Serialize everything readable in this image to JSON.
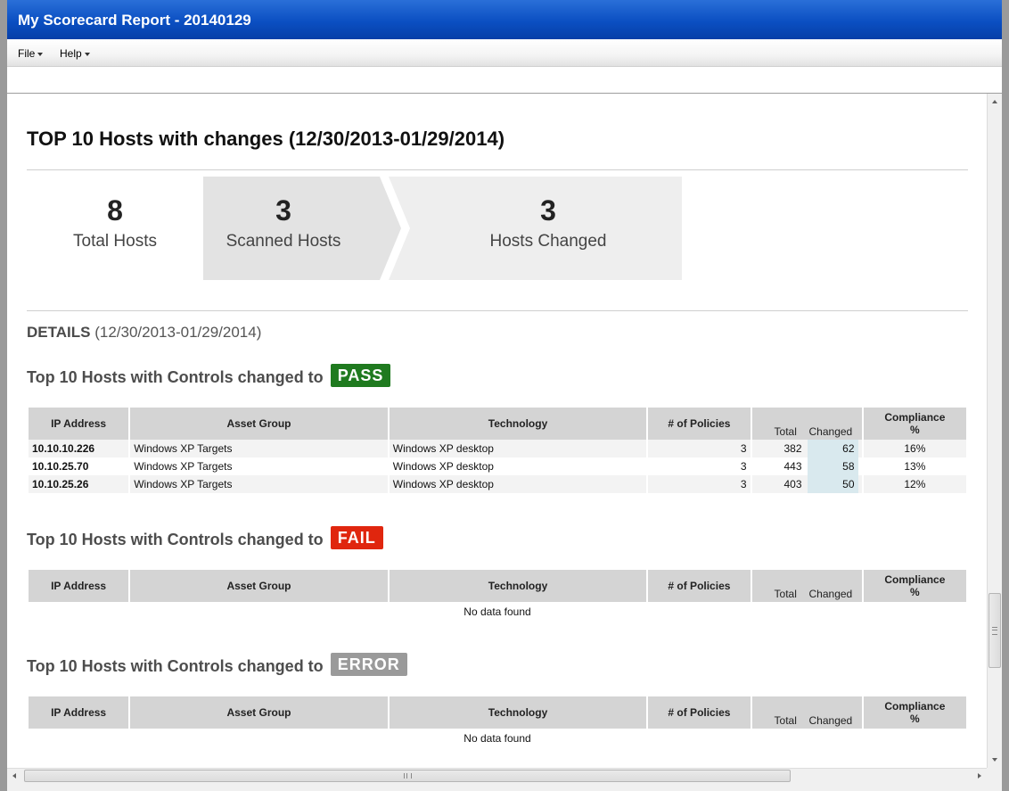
{
  "window": {
    "title": "My Scorecard Report - 20140129"
  },
  "menu": [
    {
      "label": "File"
    },
    {
      "label": "Help"
    }
  ],
  "report": {
    "title": "TOP 10 Hosts with changes (12/30/2013-01/29/2014)",
    "stats": [
      {
        "value": "8",
        "label": "Total Hosts"
      },
      {
        "value": "3",
        "label": "Scanned Hosts"
      },
      {
        "value": "3",
        "label": "Hosts Changed"
      }
    ],
    "details_label": "DETAILS",
    "details_range": "(12/30/2013-01/29/2014)"
  },
  "columns": {
    "ip": "IP Address",
    "asset_group": "Asset Group",
    "technology": "Technology",
    "policies": "# of Policies",
    "total": "Total",
    "changed": "Changed",
    "compliance_line1": "Compliance",
    "compliance_line2": "%"
  },
  "sections": [
    {
      "heading": "Top 10 Hosts with Controls changed to",
      "badge": "PASS",
      "badge_color": "#1f7a1f",
      "rows": [
        {
          "ip": "10.10.10.226",
          "asset_group": "Windows XP Targets",
          "technology": "Windows XP desktop",
          "policies": "3",
          "total": "382",
          "changed": "62",
          "compliance": "16%"
        },
        {
          "ip": "10.10.25.70",
          "asset_group": "Windows XP Targets",
          "technology": "Windows XP desktop",
          "policies": "3",
          "total": "443",
          "changed": "58",
          "compliance": "13%"
        },
        {
          "ip": "10.10.25.26",
          "asset_group": "Windows XP Targets",
          "technology": "Windows XP desktop",
          "policies": "3",
          "total": "403",
          "changed": "50",
          "compliance": "12%"
        }
      ]
    },
    {
      "heading": "Top 10 Hosts with Controls changed to",
      "badge": "FAIL",
      "badge_color": "#e0260e",
      "no_data": "No data found"
    },
    {
      "heading": "Top 10 Hosts with Controls changed to",
      "badge": "ERROR",
      "badge_color": "#9a9a9a",
      "no_data": "No data found"
    }
  ],
  "icons": {
    "menu_caret": "chevron-down-icon",
    "scroll_up": "arrow-up-icon",
    "scroll_down": "arrow-down-icon",
    "scroll_left": "arrow-left-icon",
    "scroll_right": "arrow-right-icon"
  }
}
